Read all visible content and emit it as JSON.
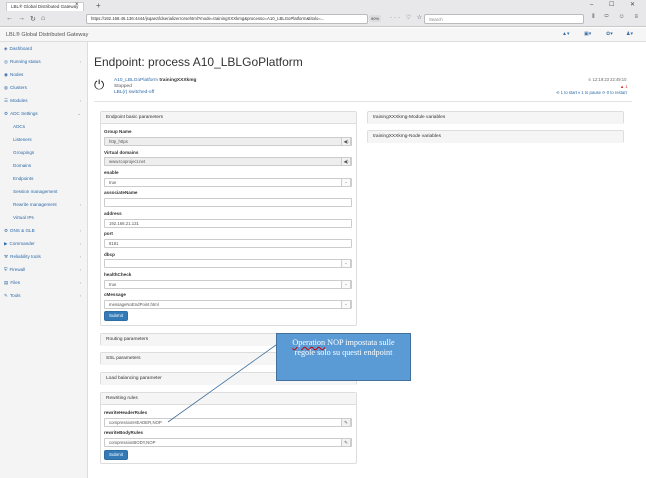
{
  "browser": {
    "tab_title": "LBL® Global Distributed Gateway",
    "tab_close": "×",
    "new_tab": "+",
    "window_controls": "– ☐ ✕",
    "url": "https://192.168.46.136:4444/jsqaez/ldserializerrorsehtml?mode=trainingXXXkmg&processo=A10_LBLGoPlatform&titolo=...",
    "zoom": "90%",
    "url_icons": "··· ♡ ☆",
    "search_placeholder": "Search",
    "tool_icons": "⫴ ▭ ☺ ≡",
    "back": "←",
    "forward": "→",
    "reload": "↻",
    "home": "⌂"
  },
  "topbar": {
    "brand": "LBL® Global Distributed Gateway",
    "icons": [
      "▲▾",
      "▣▾",
      "✿▾",
      "♟▾"
    ]
  },
  "sidebar": {
    "items": [
      {
        "icon": "◈",
        "label": "Dashboard",
        "caret": ""
      },
      {
        "icon": "◎",
        "label": "Running status",
        "caret": "‹"
      },
      {
        "icon": "◉",
        "label": "Nodes",
        "caret": ""
      },
      {
        "icon": "◍",
        "label": "Clusters",
        "caret": ""
      },
      {
        "icon": "☰",
        "label": "Modules",
        "caret": "‹"
      },
      {
        "icon": "⚙",
        "label": "ADC Settings",
        "caret": "⌄"
      },
      {
        "icon": "",
        "label": "ADCs",
        "caret": ""
      },
      {
        "icon": "",
        "label": "Listeners",
        "caret": ""
      },
      {
        "icon": "",
        "label": "Groupings",
        "caret": ""
      },
      {
        "icon": "",
        "label": "Domains",
        "caret": ""
      },
      {
        "icon": "",
        "label": "Endpoints",
        "caret": ""
      },
      {
        "icon": "",
        "label": "Session management",
        "caret": ""
      },
      {
        "icon": "",
        "label": "Rewrite management",
        "caret": "‹"
      },
      {
        "icon": "",
        "label": "Virtual IPs",
        "caret": ""
      },
      {
        "icon": "⚙",
        "label": "DNS & GLB",
        "caret": "‹"
      },
      {
        "icon": "▶",
        "label": "Commander",
        "caret": "‹"
      },
      {
        "icon": "⚒",
        "label": "Reliability tools",
        "caret": "‹"
      },
      {
        "icon": "⛨",
        "label": "Firewall",
        "caret": "‹"
      },
      {
        "icon": "▤",
        "label": "Files",
        "caret": "‹"
      },
      {
        "icon": "✎",
        "label": "Tools",
        "caret": "‹"
      }
    ]
  },
  "page": {
    "title": "Endpoint: process A10_LBLGoPlatform"
  },
  "endpoint": {
    "power_icon": "⏻",
    "name": "A10_LBLGoPlatform",
    "training": "trainingXXXkmg",
    "status": "Stopped",
    "switch": "LBL(r) switched-off",
    "timestamp": "⊙ 12:19:23 22:49:10",
    "warning": "▲ 1",
    "links": "⟲ 1 to start  ⏸ 1 to pause  ⟳ 0 to restart"
  },
  "basic": {
    "title": "Endpoint basic parameters",
    "save_icon": "◀)",
    "caret": "⌄",
    "group_label": "Group Name",
    "group_value": "http_https",
    "vdomain_label": "Virtual domains",
    "vdomain_value": "www.tcoproject.net",
    "enable_label": "enable",
    "enable_value": "true",
    "assoc_label": "associateName",
    "assoc_value": "",
    "address_label": "address",
    "address_value": "192.168.21.131",
    "port_label": "port",
    "port_value": "8181",
    "dbcp_label": "dbcp",
    "dbcp_value": "",
    "health_label": "healthCheck",
    "health_value": "true",
    "cmessage_label": "cMessage",
    "cmessage_value": "messageNoEndPoint.html",
    "submit": "Submit"
  },
  "side_panels": {
    "module_vars": "trainingXXXkmg-Module variables",
    "node_vars": "trainingXXXkmg-Node variables"
  },
  "collapsed": {
    "routing": "Routing parameters",
    "ssl": "SSL parameters",
    "lb": "Load balancing parameter"
  },
  "rewriting": {
    "title": "Rewriting rules",
    "edit_icon": "✎",
    "header_label": "rewriteHeaderRules",
    "header_value": "compressionHEADER,NOP",
    "body_label": "rewriteBodyRules",
    "body_value": "compressionBODY,NOP",
    "submit": "Submit"
  },
  "callout": {
    "linked": "Operation",
    "text": " NOP impostata sulle regole solo su questi endpoint"
  }
}
